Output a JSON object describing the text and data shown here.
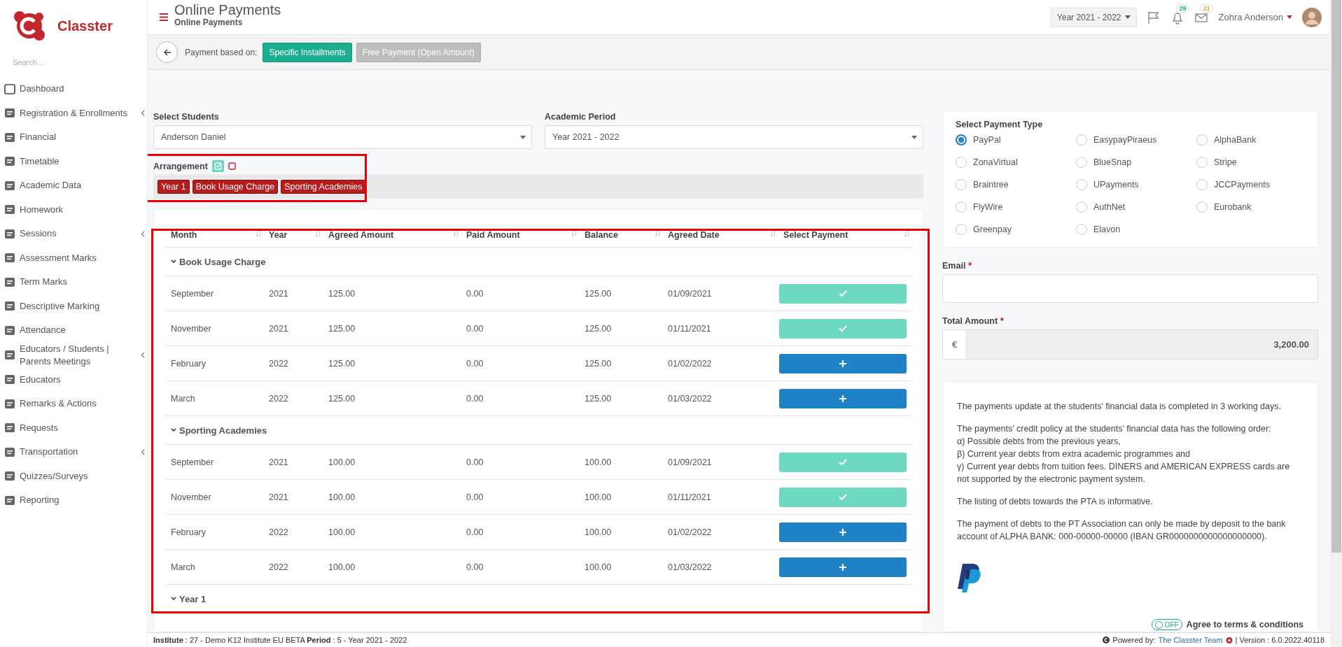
{
  "sidebar": {
    "brand": "Classter",
    "search": {
      "placeholder": "Search..."
    },
    "items": [
      {
        "label": "Dashboard",
        "has_submenu": false
      },
      {
        "label": "Registration & Enrollments",
        "has_submenu": true
      },
      {
        "label": "Financial",
        "has_submenu": false
      },
      {
        "label": "Timetable",
        "has_submenu": false
      },
      {
        "label": "Academic Data",
        "has_submenu": false
      },
      {
        "label": "Homework",
        "has_submenu": false
      },
      {
        "label": "Sessions",
        "has_submenu": true
      },
      {
        "label": "Assessment Marks",
        "has_submenu": false
      },
      {
        "label": "Term Marks",
        "has_submenu": false
      },
      {
        "label": "Descriptive Marking",
        "has_submenu": false
      },
      {
        "label": "Attendance",
        "has_submenu": false
      },
      {
        "label": "Educators / Students | Parents Meetings",
        "has_submenu": true
      },
      {
        "label": "Educators",
        "has_submenu": false
      },
      {
        "label": "Remarks & Actions",
        "has_submenu": false
      },
      {
        "label": "Requests",
        "has_submenu": false
      },
      {
        "label": "Transportation",
        "has_submenu": true
      },
      {
        "label": "Quizzes/Surveys",
        "has_submenu": false
      },
      {
        "label": "Reporting",
        "has_submenu": false
      }
    ]
  },
  "header": {
    "title": "Online Payments",
    "subtitle": "Online Payments",
    "year_selector": "Year 2021 - 2022",
    "notifications": "29",
    "messages": "21",
    "user": "Zohra Anderson"
  },
  "toolbar": {
    "label": "Payment based on:",
    "modes": [
      {
        "label": "Specific Installments",
        "selected": true
      },
      {
        "label": "Free Payment (Open Amount)",
        "selected": false
      }
    ]
  },
  "filters": [
    {
      "label": "Select Students",
      "value": "Anderson Daniel"
    },
    {
      "label": "Academic Period",
      "value": "Year 2021 - 2022"
    }
  ],
  "arrangement": {
    "label": "Arrangement",
    "tags": [
      "Year 1",
      "Book Usage Charge",
      "Sporting Academies"
    ]
  },
  "table": {
    "columns": [
      "Month",
      "Year",
      "Agreed Amount",
      "Paid Amount",
      "Balance",
      "Agreed Date",
      "Select Payment"
    ],
    "groups": [
      {
        "name": "Book Usage Charge",
        "rows": [
          {
            "cells": [
              "September",
              "2021",
              "125.00",
              "0.00",
              "125.00",
              "01/09/2021"
            ],
            "settled": true
          },
          {
            "cells": [
              "November",
              "2021",
              "125.00",
              "0.00",
              "125.00",
              "01/11/2021"
            ],
            "settled": true
          },
          {
            "cells": [
              "February",
              "2022",
              "125.00",
              "0.00",
              "125.00",
              "01/02/2022"
            ],
            "settled": false
          },
          {
            "cells": [
              "March",
              "2022",
              "125.00",
              "0.00",
              "125.00",
              "01/03/2022"
            ],
            "settled": false
          }
        ]
      },
      {
        "name": "Sporting Academies",
        "rows": [
          {
            "cells": [
              "September",
              "2021",
              "100.00",
              "0.00",
              "100.00",
              "01/09/2021"
            ],
            "settled": true
          },
          {
            "cells": [
              "November",
              "2021",
              "100.00",
              "0.00",
              "100.00",
              "01/11/2021"
            ],
            "settled": true
          },
          {
            "cells": [
              "February",
              "2022",
              "100.00",
              "0.00",
              "100.00",
              "01/02/2022"
            ],
            "settled": false
          },
          {
            "cells": [
              "March",
              "2022",
              "100.00",
              "0.00",
              "100.00",
              "01/03/2022"
            ],
            "settled": false
          }
        ]
      },
      {
        "name": "Year 1"
      }
    ]
  },
  "payment_type": {
    "title": "Select Payment Type",
    "options": [
      {
        "label": "PayPal",
        "selected": true
      },
      {
        "label": "EasypayPiraeus",
        "selected": false
      },
      {
        "label": "AlphaBank",
        "selected": false
      },
      {
        "label": "ZonaVirtual",
        "selected": false
      },
      {
        "label": "BlueSnap",
        "selected": false
      },
      {
        "label": "Stripe",
        "selected": false
      },
      {
        "label": "Braintree",
        "selected": false
      },
      {
        "label": "UPayments",
        "selected": false
      },
      {
        "label": "JCCPayments",
        "selected": false
      },
      {
        "label": "FlyWire",
        "selected": false
      },
      {
        "label": "AuthNet",
        "selected": false
      },
      {
        "label": "Eurobank",
        "selected": false
      },
      {
        "label": "Greenpay",
        "selected": false
      },
      {
        "label": "Elavon",
        "selected": false
      }
    ]
  },
  "email": {
    "label": "Email",
    "marker": "*"
  },
  "total": {
    "label": "Total Amount",
    "marker": "*",
    "currency": "€",
    "value": "3,200.00"
  },
  "info": {
    "paragraphs": [
      [
        "The payments update at the students’ financial data is completed in 3 working days."
      ],
      [
        "The payments’ credit policy at the students’ financial data has the following order:",
        " α) Possible debts from the previous years,",
        " β) Current year debts from extra academic programmes and",
        " γ) Current year debts from tuition fees. DINERS and AMERICAN EXPRESS cards are not supported by the electronic payment system."
      ],
      [
        "The listing of debts towards the PTA is informative."
      ],
      [
        "The payment of debts to the PT Association can only be made by deposit to the bank account of ALPHA BANK: 000-00000-00000 (IBAN GR0000000000000000000)."
      ]
    ]
  },
  "terms": {
    "toggle": "OFF",
    "on": false,
    "label": "Agree to terms & conditions"
  },
  "footer": {
    "institute": "**Institute** : 27 - Demo K12 Institute EU BETA **Period** : 5 - Year 2021 - 2022",
    "powered": "Powered by:",
    "team": "The Classter Team",
    "version": "| Version : 6.0.2022.40118"
  }
}
